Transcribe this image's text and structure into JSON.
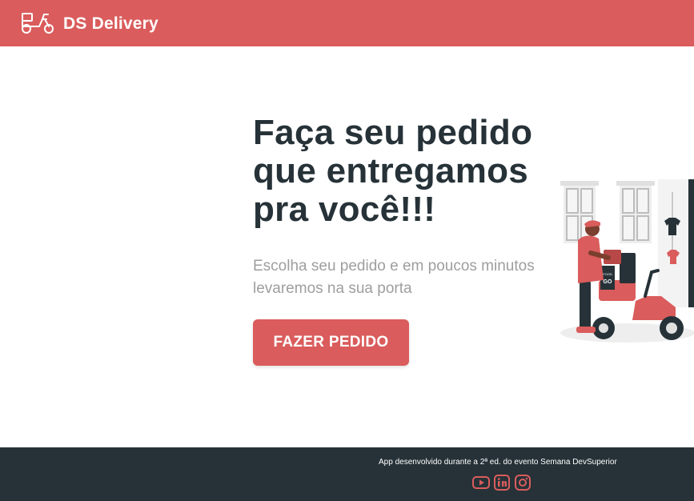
{
  "navbar": {
    "brand": "DS Delivery",
    "logo_icon": "scooter-icon",
    "background": "#DA5C5C"
  },
  "hero": {
    "title": "Faça seu pedido que entregamos pra você!!!",
    "subtitle": "Escolha seu pedido e em poucos minutos levaremos na sua porta",
    "cta_label": "FAZER PEDIDO",
    "illustration": "delivery-scooter-illustration"
  },
  "footer": {
    "text": "App desenvolvido durante a 2ª ed. do evento Semana DevSuperior",
    "social_icons": [
      "youtube-icon",
      "linkedin-icon",
      "instagram-icon"
    ],
    "icon_color": "#DA5C5C",
    "background": "#263238"
  },
  "colors": {
    "primary": "#DA5C5C",
    "dark": "#263238",
    "muted": "#9E9E9E"
  }
}
